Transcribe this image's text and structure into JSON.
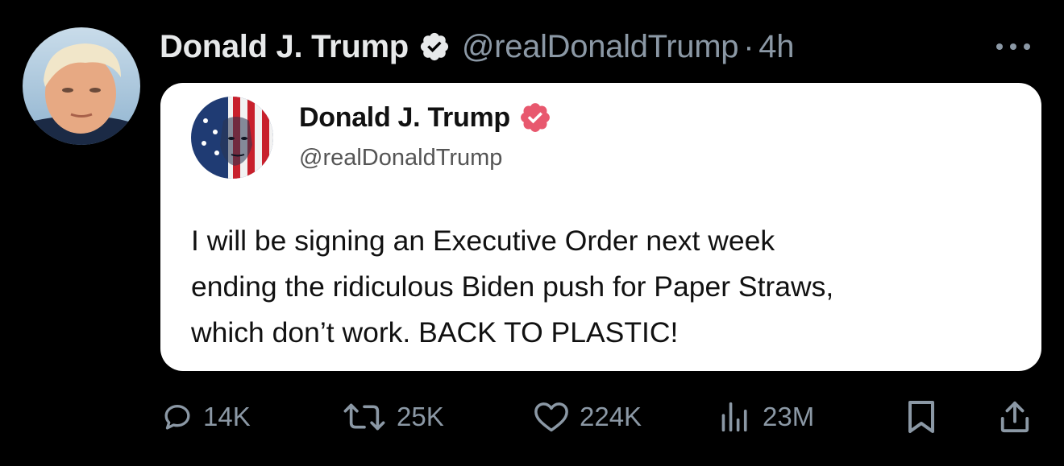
{
  "post": {
    "author_name": "Donald J. Trump",
    "handle": "@realDonaldTrump",
    "separator": "·",
    "time": "4h"
  },
  "quoted": {
    "author_name": "Donald J. Trump",
    "handle": "@realDonaldTrump",
    "text_lines": [
      "I will be signing an Executive Order next week",
      "ending the ridiculous Biden push for Paper Straws,",
      "which don’t work. BACK TO PLASTIC!"
    ]
  },
  "actions": {
    "replies": "14K",
    "reposts": "25K",
    "likes": "224K",
    "views": "23M"
  },
  "icons": {
    "verified": "verified-badge-icon",
    "more": "more-dots-icon",
    "reply": "reply-bubble-icon",
    "repost": "repost-arrows-icon",
    "like": "heart-icon",
    "views": "bar-chart-icon",
    "bookmark": "bookmark-icon",
    "share": "share-icon"
  },
  "colors": {
    "background": "#000000",
    "primary_text": "#e7e9ea",
    "secondary_text": "#8b98a5",
    "card_background": "#ffffff",
    "verified_header": "#e7e9ea",
    "verified_card": "#e8586e"
  }
}
